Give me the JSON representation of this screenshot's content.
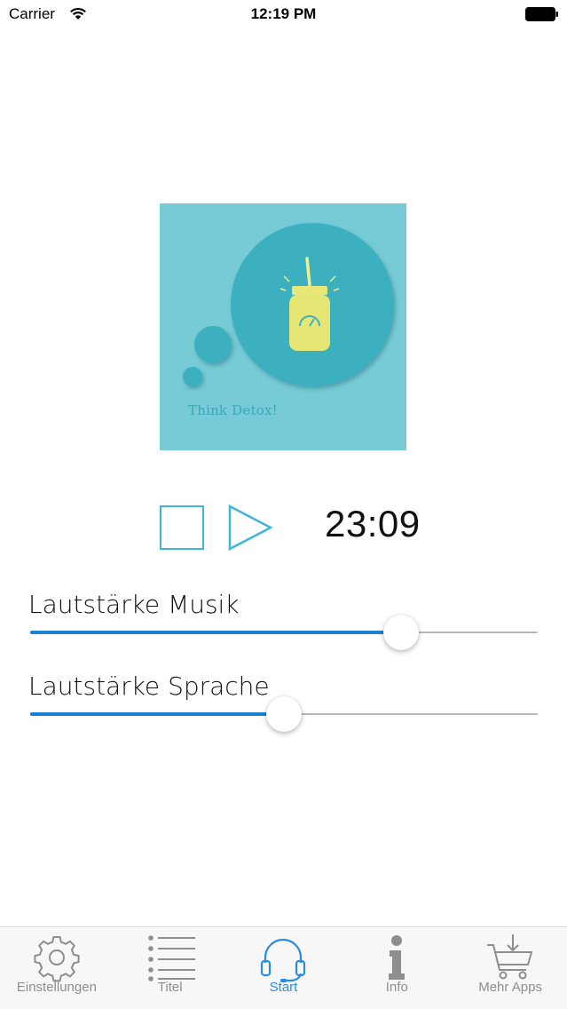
{
  "status_bar": {
    "carrier": "Carrier",
    "time": "12:19 PM"
  },
  "artwork": {
    "caption": "Think Detox!"
  },
  "player": {
    "timer": "23:09"
  },
  "sliders": [
    {
      "label": "Lautstärke Musik",
      "value": 0.73
    },
    {
      "label": "Lautstärke Sprache",
      "value": 0.5
    }
  ],
  "tab_bar": {
    "tabs": [
      {
        "label": "Einstellungen",
        "icon": "gear-icon",
        "active": false
      },
      {
        "label": "Titel",
        "icon": "list-icon",
        "active": false
      },
      {
        "label": "Start",
        "icon": "headphones-icon",
        "active": true
      },
      {
        "label": "Info",
        "icon": "info-icon",
        "active": false
      },
      {
        "label": "Mehr Apps",
        "icon": "cart-icon",
        "active": false
      }
    ]
  },
  "colors": {
    "accent": "#1c7fd8",
    "control": "#3fb6d9",
    "tab_active": "#2a8ee0",
    "tab_inactive": "#8e8e8e",
    "artwork_bg": "#76cbd6"
  }
}
